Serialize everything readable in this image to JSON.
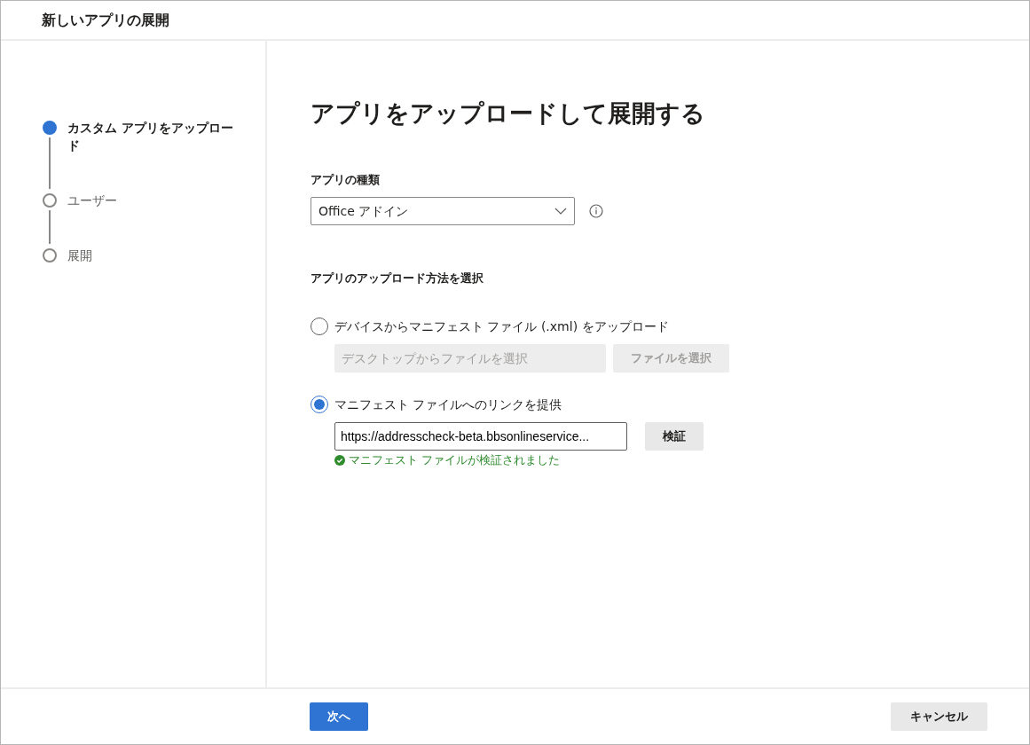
{
  "window": {
    "title": "新しいアプリの展開"
  },
  "steps": [
    {
      "label": "カスタム アプリをアップロード",
      "selected": true
    },
    {
      "label": "ユーザー",
      "selected": false
    },
    {
      "label": "展開",
      "selected": false
    }
  ],
  "heading": "アプリをアップロードして展開する",
  "app_type": {
    "label": "アプリの種類",
    "value": "Office アドイン"
  },
  "upload_method": {
    "label": "アプリのアップロード方法を選択",
    "options": [
      {
        "kind": "file",
        "label": "デバイスからマニフェスト ファイル (.xml) をアップロード",
        "selected": false,
        "disabled": true,
        "placeholder": "デスクトップからファイルを選択",
        "button": "ファイルを選択"
      },
      {
        "kind": "url",
        "label": "マニフェスト ファイルへのリンクを提供",
        "selected": true,
        "disabled": false,
        "value": "https://addresscheck-beta.bbsonlineservice...",
        "button": "検証",
        "message": "マニフェスト ファイルが検証されました"
      }
    ]
  },
  "footer": {
    "next": "次へ",
    "cancel": "キャンセル"
  }
}
